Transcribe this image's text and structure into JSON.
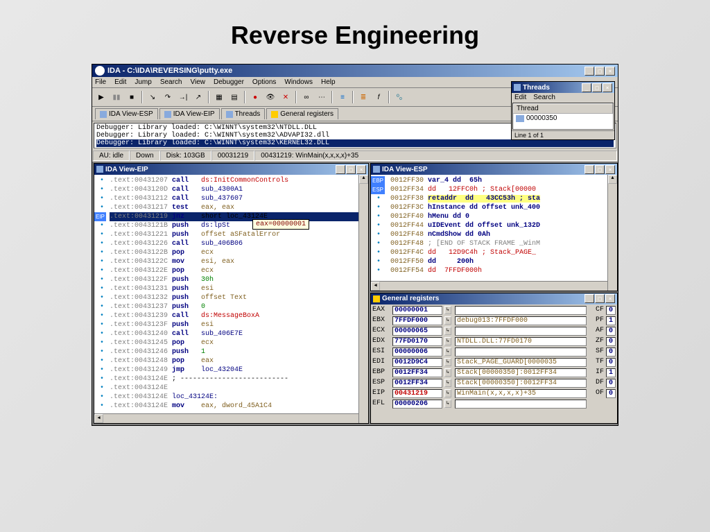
{
  "slide": {
    "title": "Reverse Engineering"
  },
  "app": {
    "title": "IDA - C:\\IDA\\REVERSING\\putty.exe",
    "menu": [
      "File",
      "Edit",
      "Jump",
      "Search",
      "View",
      "Debugger",
      "Options",
      "Windows",
      "Help"
    ]
  },
  "tabs": [
    {
      "label": "IDA View-ESP",
      "icon": "blue"
    },
    {
      "label": "IDA View-EIP",
      "icon": "blue"
    },
    {
      "label": "Threads",
      "icon": "blue"
    },
    {
      "label": "General registers",
      "icon": "yellow"
    }
  ],
  "log": [
    "Debugger: Library loaded: C:\\WINNT\\system32\\NTDLL.DLL",
    "Debugger: Library loaded: C:\\WINNT\\system32\\ADVAPI32.dll",
    "Debugger: Library loaded: C:\\WINNT\\system32\\KERNEL32.DLL"
  ],
  "status": {
    "au": "AU: idle",
    "dir": "Down",
    "disk": "Disk: 103GB",
    "addr": "00031219",
    "loc": "00431219: WinMain(x,x,x,x)+35"
  },
  "threads": {
    "title": "Threads",
    "menu": [
      "Edit",
      "Search"
    ],
    "header": "Thread",
    "rows": [
      "00000350"
    ],
    "footer": "Line 1 of 1"
  },
  "eip_view": {
    "title": "IDA View-EIP",
    "tooltip": "eax=00000001",
    "lines": [
      {
        "addr": ".text:00431207",
        "mnem": "call",
        "op": "ds:InitCommonControls",
        "opc": "red"
      },
      {
        "addr": ".text:0043120D",
        "mnem": "call",
        "op": "sub_4300A1",
        "opc": "blue"
      },
      {
        "addr": ".text:00431212",
        "mnem": "call",
        "op": "sub_437607",
        "opc": "blue"
      },
      {
        "addr": ".text:00431217",
        "mnem": "test",
        "op": "eax, eax",
        "opc": "brown"
      },
      {
        "addr": ".text:00431219",
        "mnem": "jnz",
        "op": "short loc_43124E",
        "selected": true,
        "eip": true
      },
      {
        "addr": ".text:0043121B",
        "mnem": "push",
        "op": "ds:lpSt",
        "opc": "blue"
      },
      {
        "addr": ".text:00431221",
        "mnem": "push",
        "op": "offset aSFatalError",
        "opc": "brown"
      },
      {
        "addr": ".text:00431226",
        "mnem": "call",
        "op": "sub_406B06",
        "opc": "blue"
      },
      {
        "addr": ".text:0043122B",
        "mnem": "pop",
        "op": "ecx",
        "opc": "brown"
      },
      {
        "addr": ".text:0043122C",
        "mnem": "mov",
        "op": "esi, eax",
        "opc": "brown"
      },
      {
        "addr": ".text:0043122E",
        "mnem": "pop",
        "op": "ecx",
        "opc": "brown"
      },
      {
        "addr": ".text:0043122F",
        "mnem": "push",
        "op": "30h",
        "opc": "green"
      },
      {
        "addr": ".text:00431231",
        "mnem": "push",
        "op": "esi",
        "opc": "brown"
      },
      {
        "addr": ".text:00431232",
        "mnem": "push",
        "op": "offset Text",
        "opc": "brown"
      },
      {
        "addr": ".text:00431237",
        "mnem": "push",
        "op": "0",
        "opc": "green"
      },
      {
        "addr": ".text:00431239",
        "mnem": "call",
        "op": "ds:MessageBoxA",
        "opc": "red"
      },
      {
        "addr": ".text:0043123F",
        "mnem": "push",
        "op": "esi",
        "opc": "brown"
      },
      {
        "addr": ".text:00431240",
        "mnem": "call",
        "op": "sub_406E7E",
        "opc": "blue"
      },
      {
        "addr": ".text:00431245",
        "mnem": "pop",
        "op": "ecx",
        "opc": "brown"
      },
      {
        "addr": ".text:00431246",
        "mnem": "push",
        "op": "1",
        "opc": "green"
      },
      {
        "addr": ".text:00431248",
        "mnem": "pop",
        "op": "eax",
        "opc": "brown"
      },
      {
        "addr": ".text:00431249",
        "mnem": "jmp",
        "op": "loc_43204E",
        "opc": "blue"
      },
      {
        "addr": ".text:0043124E",
        "mnem": ";",
        "op": "--------------------------",
        "opc": "black",
        "comment": true
      },
      {
        "addr": ".text:0043124E",
        "mnem": "",
        "op": "",
        "opc": "black"
      },
      {
        "addr": ".text:0043124E",
        "mnem": "loc_43124E:",
        "op": "",
        "opc": "blue",
        "label": true
      },
      {
        "addr": ".text:0043124E",
        "mnem": "mov",
        "op": "eax, dword_45A1C4",
        "opc": "brown"
      }
    ]
  },
  "esp_view": {
    "title": "IDA View-ESP",
    "lines": [
      {
        "addr": "0012FF30",
        "body": "var_4 dd  65h",
        "badge": "EBP"
      },
      {
        "addr": "0012FF34",
        "body": "dd   12FFC0h ; Stack[00000",
        "badge": "ESP",
        "red": true
      },
      {
        "addr": "0012FF38",
        "body": "retaddr  dd   43CC53h ; sta",
        "hl": true
      },
      {
        "addr": "0012FF3C",
        "body": "hInstance dd offset unk_400"
      },
      {
        "addr": "0012FF40",
        "body": "hMenu dd 0"
      },
      {
        "addr": "0012FF44",
        "body": "uIDEvent dd offset unk_132D"
      },
      {
        "addr": "0012FF48",
        "body": "nCmdShow dd 0Ah"
      },
      {
        "addr": "0012FF48",
        "body": "; [END OF STACK FRAME _WinM",
        "grey": true
      },
      {
        "addr": "0012FF4C",
        "body": "dd   12D9C4h ; Stack_PAGE_",
        "red": true
      },
      {
        "addr": "0012FF50",
        "body": "dd     200h"
      },
      {
        "addr": "0012FF54",
        "body": "dd  7FFDF000h",
        "red": true
      }
    ]
  },
  "regs": {
    "title": "General registers",
    "rows": [
      {
        "name": "EAX",
        "val": "00000001",
        "desc": "",
        "flag": "CF",
        "fv": "0"
      },
      {
        "name": "EBX",
        "val": "7FFDF000",
        "desc": "debug013:7FFDF000",
        "flag": "PF",
        "fv": "1"
      },
      {
        "name": "ECX",
        "val": "00000065",
        "desc": "",
        "flag": "AF",
        "fv": "0"
      },
      {
        "name": "EDX",
        "val": "77FD0170",
        "desc": "NTDLL.DLL:77FD0170",
        "flag": "ZF",
        "fv": "0"
      },
      {
        "name": "ESI",
        "val": "00000006",
        "desc": "",
        "flag": "SF",
        "fv": "0"
      },
      {
        "name": "EDI",
        "val": "0012D9C4",
        "desc": "Stack_PAGE_GUARD[0000035",
        "flag": "TF",
        "fv": "0"
      },
      {
        "name": "EBP",
        "val": "0012FF34",
        "desc": "Stack[00000350]:0012FF34",
        "flag": "IF",
        "fv": "1"
      },
      {
        "name": "ESP",
        "val": "0012FF34",
        "desc": "Stack[00000350]:0012FF34",
        "flag": "DF",
        "fv": "0"
      },
      {
        "name": "EIP",
        "val": "00431219",
        "desc": "WinMain(x,x,x,x)+35",
        "flag": "OF",
        "fv": "0",
        "red": true
      },
      {
        "name": "EFL",
        "val": "00000206",
        "desc": "",
        "flag": "",
        "fv": ""
      }
    ]
  }
}
